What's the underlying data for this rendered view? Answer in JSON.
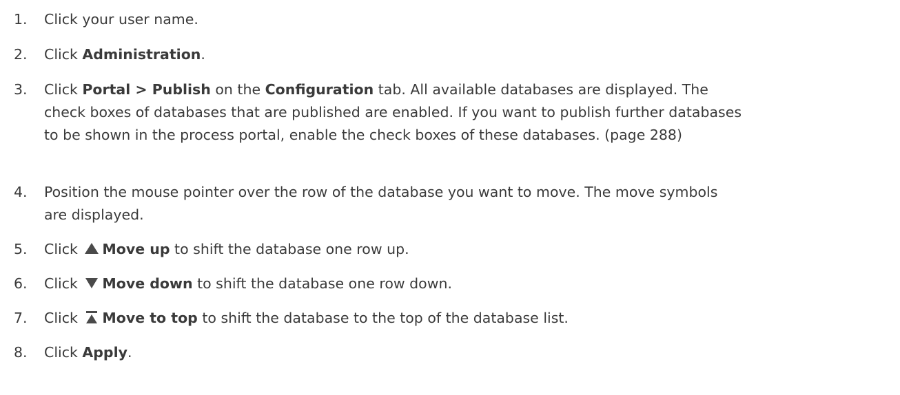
{
  "steps": [
    {
      "number": "1.",
      "parts": [
        {
          "text": "Click your user name."
        }
      ]
    },
    {
      "number": "2.",
      "parts": [
        {
          "text": "Click "
        },
        {
          "text": "Administration",
          "bold": true
        },
        {
          "text": "."
        }
      ]
    },
    {
      "number": "3.",
      "parts": [
        {
          "text": "Click "
        },
        {
          "text": "Portal > Publish",
          "bold": true
        },
        {
          "text": " on the "
        },
        {
          "text": "Configuration",
          "bold": true
        },
        {
          "text": " tab. All available databases are displayed. The check boxes of databases that are published are enabled. If you want to publish further databases to be shown in the process portal, enable the check boxes of these databases. (page 288)"
        }
      ]
    },
    {
      "number": "4.",
      "parts": [
        {
          "text": "Position the mouse pointer over the row of the database you want to move. The move symbols are displayed."
        }
      ]
    },
    {
      "number": "5.",
      "parts": [
        {
          "text": "Click "
        },
        {
          "icon": "move-up-icon"
        },
        {
          "text": "Move up",
          "bold": true
        },
        {
          "text": " to shift the database one row up."
        }
      ]
    },
    {
      "number": "6.",
      "parts": [
        {
          "text": "Click "
        },
        {
          "icon": "move-down-icon"
        },
        {
          "text": "Move down",
          "bold": true
        },
        {
          "text": " to shift the database one row down."
        }
      ]
    },
    {
      "number": "7.",
      "parts": [
        {
          "text": "Click "
        },
        {
          "icon": "move-to-top-icon"
        },
        {
          "text": "Move to top",
          "bold": true
        },
        {
          "text": " to shift the database to the top of the database list."
        }
      ]
    },
    {
      "number": "8.",
      "parts": [
        {
          "text": "Click "
        },
        {
          "text": "Apply",
          "bold": true
        },
        {
          "text": "."
        }
      ]
    }
  ],
  "colors": {
    "text": "#3a3a3a",
    "icon": "#4a4a4a"
  }
}
